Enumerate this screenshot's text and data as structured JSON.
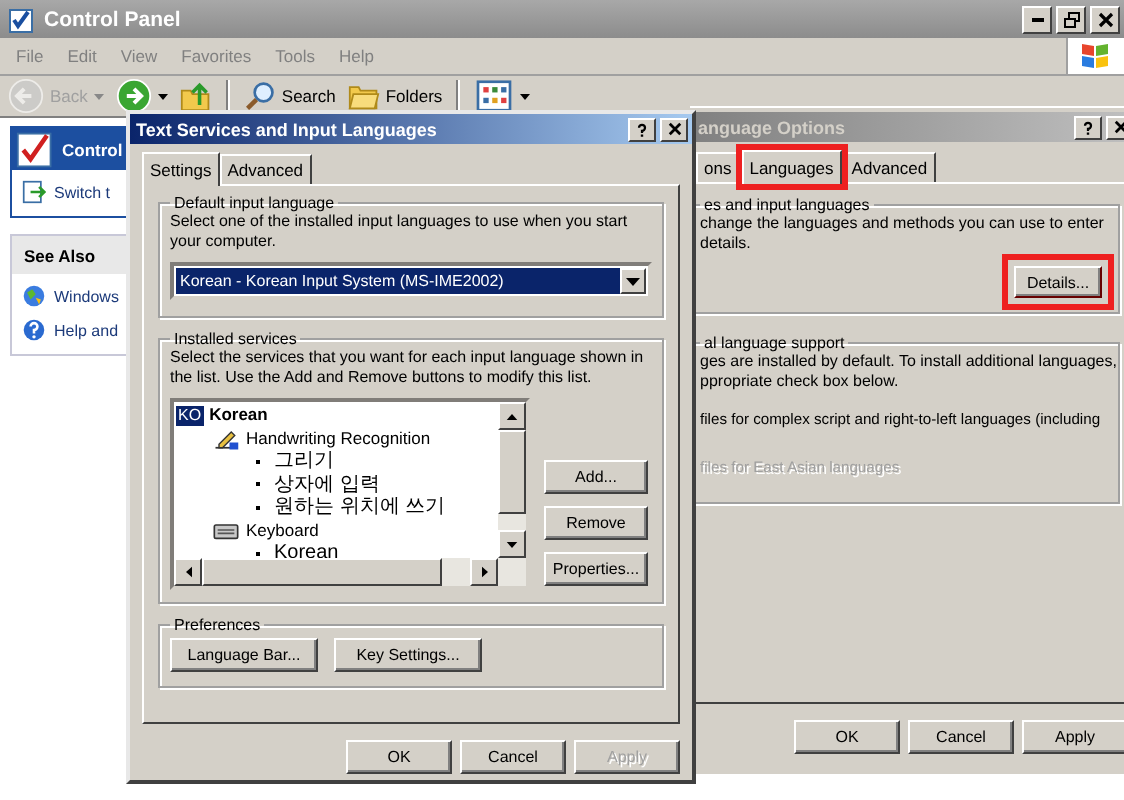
{
  "control_panel": {
    "title": "Control Panel",
    "menu": [
      "File",
      "Edit",
      "View",
      "Favorites",
      "Tools",
      "Help"
    ],
    "toolbar": [
      {
        "kind": "back",
        "label": "Back",
        "disabled": true
      },
      {
        "kind": "forward",
        "disabled": false
      },
      {
        "kind": "up",
        "disabled": false
      },
      {
        "kind": "search",
        "label": "Search",
        "disabled": false
      },
      {
        "kind": "folders",
        "label": "Folders",
        "disabled": false
      },
      {
        "kind": "views",
        "disabled": false
      }
    ],
    "task_panes": [
      {
        "title": "Control",
        "links": [
          {
            "kind": "switch",
            "label": "Switch t"
          }
        ]
      },
      {
        "title": "See Also",
        "links": [
          {
            "kind": "windows",
            "label": "Windows"
          },
          {
            "kind": "help",
            "label": "Help and"
          }
        ]
      }
    ]
  },
  "language_options": {
    "title": "anguage Options",
    "tabs": [
      {
        "label": "ons",
        "selected": false,
        "highlighted": false
      },
      {
        "label": "Languages",
        "selected": true,
        "highlighted": true
      },
      {
        "label": "Advanced",
        "selected": false,
        "highlighted": false
      }
    ],
    "input_group": {
      "label": "es and input languages",
      "lines": [
        "change the languages and methods you can use to enter",
        "details."
      ],
      "button": {
        "label": "Details...",
        "highlighted": true
      }
    },
    "support_group": {
      "label": "al language support",
      "lines": [
        "ges are installed by default. To install additional languages,",
        "ppropriate check box below."
      ],
      "options": [
        {
          "label": "files for complex script and right-to-left languages (including",
          "disabled": false
        },
        {
          "label": "files for East Asian languages",
          "disabled": true
        }
      ]
    },
    "buttons": [
      {
        "label": "OK",
        "disabled": false
      },
      {
        "label": "Cancel",
        "disabled": false
      },
      {
        "label": "Apply",
        "disabled": false
      }
    ]
  },
  "text_services": {
    "title": "Text Services and Input Languages",
    "tabs": [
      {
        "label": "Settings",
        "selected": true
      },
      {
        "label": "Advanced",
        "selected": false
      }
    ],
    "default_language": {
      "label": "Default input language",
      "description": "Select one of the installed input languages to use when you start your computer.",
      "value": "Korean - Korean Input System (MS-IME2002)"
    },
    "services": {
      "label": "Installed services",
      "description": "Select the services that you want for each input language shown in the list. Use the Add and Remove buttons to modify this list.",
      "tree": [
        {
          "kind": "language",
          "badge": "KO",
          "label": "Korean",
          "selected": true,
          "children": [
            {
              "kind": "handwriting",
              "label": "Handwriting Recognition",
              "selected": false,
              "children": [
                {
                  "kind": "option",
                  "label": "그리기",
                  "selected": false
                },
                {
                  "kind": "option",
                  "label": "상자에 입력",
                  "selected": false
                },
                {
                  "kind": "option",
                  "label": "원하는 위치에 쓰기",
                  "selected": false
                }
              ]
            },
            {
              "kind": "keyboard",
              "label": "Keyboard",
              "selected": false,
              "children": [
                {
                  "kind": "option",
                  "label": "Korean",
                  "selected": false
                }
              ]
            }
          ]
        }
      ],
      "buttons": [
        {
          "label": "Add...",
          "disabled": false
        },
        {
          "label": "Remove",
          "disabled": false
        },
        {
          "label": "Properties...",
          "disabled": false
        }
      ]
    },
    "preferences": {
      "label": "Preferences",
      "buttons": [
        "Language Bar...",
        "Key Settings..."
      ]
    },
    "buttons": [
      {
        "label": "OK",
        "disabled": false
      },
      {
        "label": "Cancel",
        "disabled": false
      },
      {
        "label": "Apply",
        "disabled": true
      }
    ]
  }
}
